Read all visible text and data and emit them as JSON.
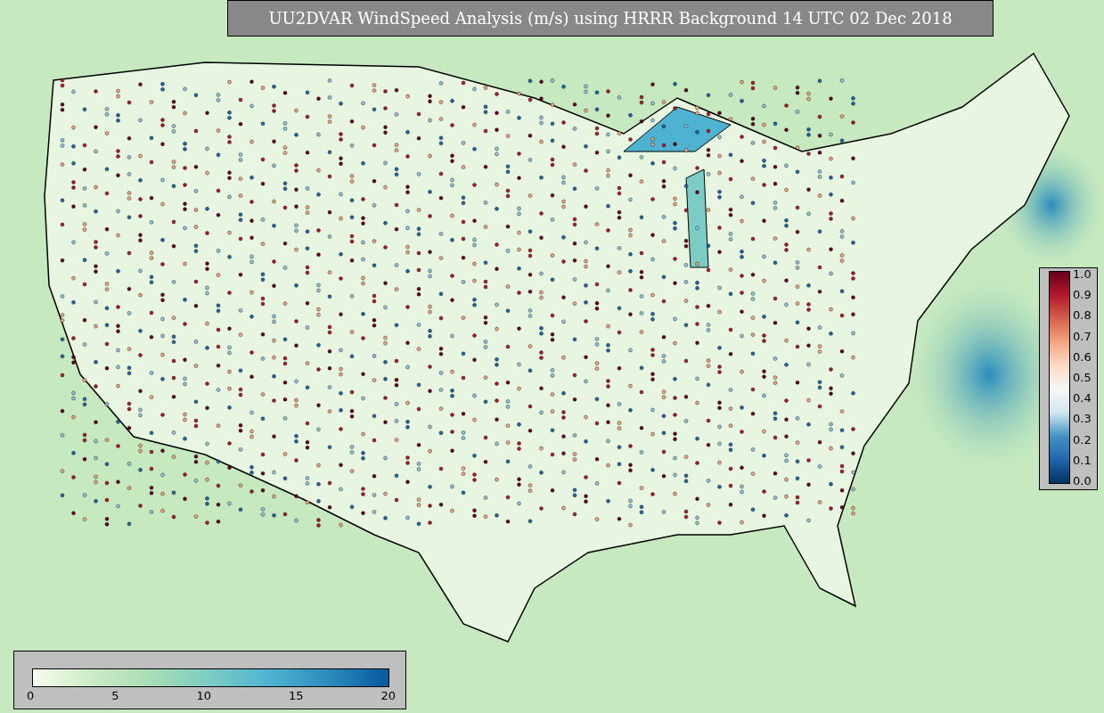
{
  "title": "UU2DVAR WindSpeed Analysis (m/s) using HRRR Background 14 UTC 02 Dec 2018",
  "fraction_colorbar": {
    "ticks": [
      "1.0",
      "0.9",
      "0.8",
      "0.7",
      "0.6",
      "0.5",
      "0.4",
      "0.3",
      "0.2",
      "0.1",
      "0.0"
    ]
  },
  "speed_colorbar": {
    "ticks": [
      "0",
      "5",
      "10",
      "15",
      "20"
    ]
  }
}
